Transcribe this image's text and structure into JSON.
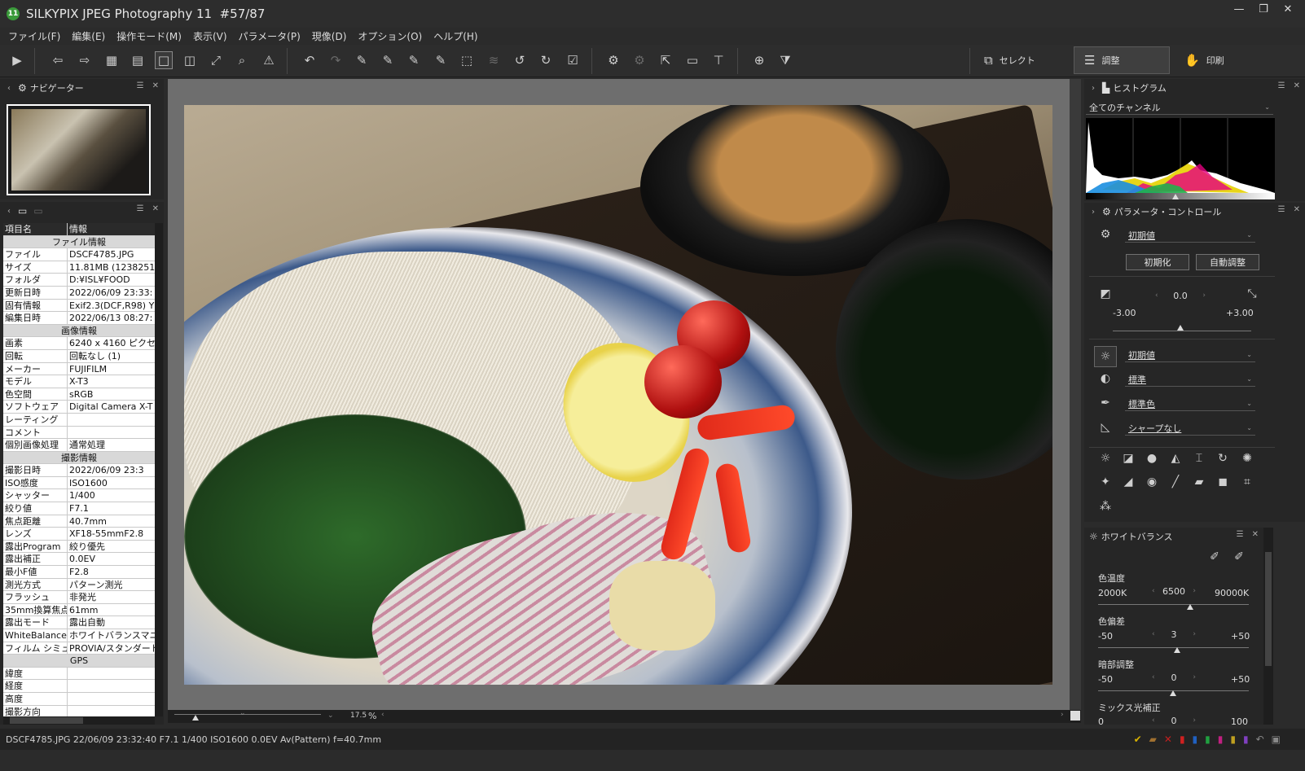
{
  "window": {
    "app_badge": "11",
    "title": "SILKYPIX JPEG Photography 11",
    "counter": "#57/87",
    "controls": [
      "—",
      "❐",
      "✕"
    ]
  },
  "menu": [
    "ファイル(F)",
    "編集(E)",
    "操作モード(M)",
    "表示(V)",
    "パラメータ(P)",
    "現像(D)",
    "オプション(O)",
    "ヘルプ(H)"
  ],
  "modes": {
    "select": "セレクト",
    "adjust": "調整",
    "print": "印刷"
  },
  "navigator": {
    "title": "ナビゲーター"
  },
  "info_panel": {
    "header": {
      "key": "項目名",
      "value": "情報"
    },
    "sections": {
      "file": "ファイル情報",
      "image": "画像情報",
      "shooting": "撮影情報",
      "gps": "GPS"
    },
    "file_rows": [
      {
        "k": "ファイル",
        "v": "DSCF4785.JPG"
      },
      {
        "k": "サイズ",
        "v": "11.81MB (1238251"
      },
      {
        "k": "フォルダ",
        "v": "D:¥ISL¥FOOD"
      },
      {
        "k": "更新日時",
        "v": "2022/06/09 23:33:"
      },
      {
        "k": "固有情報",
        "v": "Exif2.3(DCF,R98) Y"
      },
      {
        "k": "編集日時",
        "v": "2022/06/13 08:27:"
      }
    ],
    "image_rows": [
      {
        "k": "画素",
        "v": "6240 x 4160 ピクセ"
      },
      {
        "k": "回転",
        "v": "回転なし (1)"
      },
      {
        "k": "メーカー",
        "v": "FUJIFILM"
      },
      {
        "k": "モデル",
        "v": "X-T3"
      },
      {
        "k": "色空間",
        "v": "sRGB"
      },
      {
        "k": "ソフトウェア",
        "v": "Digital Camera X-T"
      },
      {
        "k": "レーティング",
        "v": ""
      },
      {
        "k": "コメント",
        "v": ""
      },
      {
        "k": "個別画像処理",
        "v": "通常処理"
      }
    ],
    "shooting_rows": [
      {
        "k": "撮影日時",
        "v": "2022/06/09 23:3"
      },
      {
        "k": "ISO感度",
        "v": "ISO1600"
      },
      {
        "k": "シャッター",
        "v": "1/400"
      },
      {
        "k": "絞り値",
        "v": "F7.1"
      },
      {
        "k": "焦点距離",
        "v": "40.7mm"
      },
      {
        "k": "レンズ",
        "v": "XF18-55mmF2.8"
      },
      {
        "k": "露出Program",
        "v": "絞り優先"
      },
      {
        "k": "露出補正",
        "v": "0.0EV"
      },
      {
        "k": "最小F値",
        "v": "F2.8"
      },
      {
        "k": "測光方式",
        "v": "パターン測光"
      },
      {
        "k": "フラッシュ",
        "v": "非発光"
      },
      {
        "k": "35mm換算焦点",
        "v": "61mm"
      },
      {
        "k": "露出モード",
        "v": "露出自動"
      },
      {
        "k": "WhiteBalance",
        "v": "ホワイトバランスマニュア"
      },
      {
        "k": "フィルム シミュレー",
        "v": "PROVIA/スタンダード"
      }
    ],
    "gps_rows": [
      {
        "k": "緯度",
        "v": ""
      },
      {
        "k": "経度",
        "v": ""
      },
      {
        "k": "高度",
        "v": ""
      },
      {
        "k": "撮影方向",
        "v": ""
      }
    ]
  },
  "zoom": {
    "value": "17.5",
    "unit": "%"
  },
  "histogram": {
    "title": "ヒストグラム",
    "channel": "全てのチャンネル"
  },
  "param_control": {
    "title": "パラメータ・コントロール",
    "preset": "初期値",
    "reset_label": "初期化",
    "auto_label": "自動調整",
    "exposure": {
      "value": "0.0",
      "min": "-3.00",
      "max": "+3.00",
      "current": 0.0
    },
    "tone_preset": "初期値",
    "color_preset": "標準",
    "color_mode": "標準色",
    "sharpness": "シャープなし"
  },
  "white_balance": {
    "title": "ホワイトバランス",
    "temp": {
      "label": "色温度",
      "min": "2000K",
      "max": "90000K",
      "value": "6500"
    },
    "tint": {
      "label": "色偏差",
      "min": "-50",
      "max": "+50",
      "value": "3"
    },
    "shadow": {
      "label": "暗部調整",
      "min": "-50",
      "max": "+50",
      "value": "0"
    },
    "mix": {
      "label": "ミックス光補正",
      "min": "0",
      "max": "100",
      "value": "0"
    }
  },
  "status": {
    "text": "DSCF4785.JPG 22/06/09 23:32:40 F7.1 1/400 ISO1600  0.0EV Av(Pattern) f=40.7mm"
  }
}
